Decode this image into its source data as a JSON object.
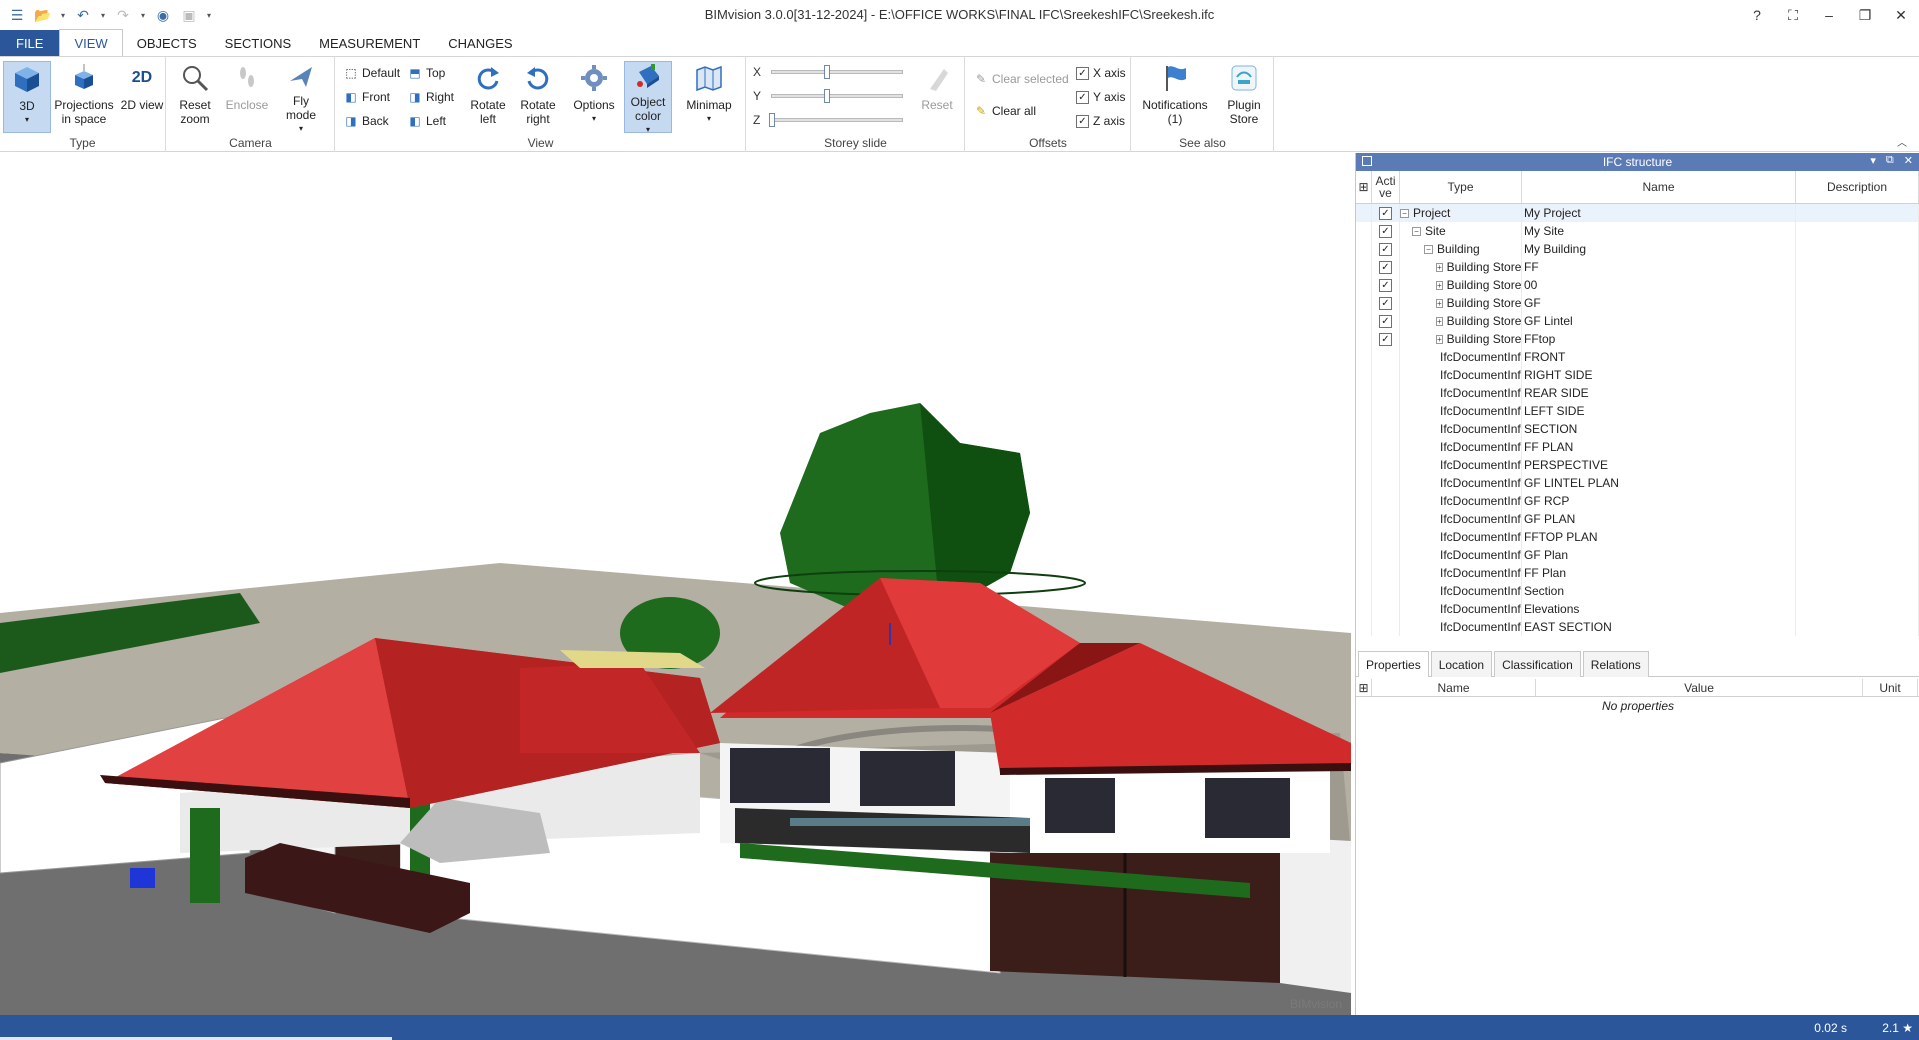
{
  "window": {
    "title": "BIMvision 3.0.0[31-12-2024] - E:\\OFFICE WORKS\\FINAL IFC\\SreekeshIFC\\Sreekesh.ifc",
    "controls": [
      "?",
      "⛶",
      "–",
      "❐",
      "✕"
    ]
  },
  "ribbon_tabs": [
    "FILE",
    "VIEW",
    "OBJECTS",
    "SECTIONS",
    "MEASUREMENT",
    "CHANGES"
  ],
  "ribbon": {
    "type_group": {
      "label": "Type",
      "btn_3d": "3D",
      "btn_proj": "Projections in space",
      "btn_2d": "2D view"
    },
    "camera_group": {
      "label": "Camera",
      "reset": "Reset zoom",
      "enclose": "Enclose",
      "fly": "Fly mode"
    },
    "view_group": {
      "label": "View",
      "default": "Default",
      "top": "Top",
      "front": "Front",
      "right": "Right",
      "back": "Back",
      "left": "Left",
      "rotate_left": "Rotate left",
      "rotate_right": "Rotate right",
      "options": "Options",
      "object_color": "Object color",
      "minimap": "Minimap"
    },
    "storey_group": {
      "label": "Storey slide",
      "x": "X",
      "y": "Y",
      "z": "Z",
      "reset": "Reset",
      "x_level": 0.42,
      "y_level": 0.42,
      "z_level": 0.0
    },
    "offsets_group": {
      "label": "Offsets",
      "clear_selected": "Clear selected",
      "clear_all": "Clear all",
      "x_axis": "X axis",
      "y_axis": "Y axis",
      "z_axis": "Z axis"
    },
    "see_also_group": {
      "label": "See also",
      "notifications": "Notifications (1)",
      "plugin_store": "Plugin Store"
    }
  },
  "ifc_panel": {
    "title": "IFC structure",
    "columns": {
      "active": "Acti ve",
      "type": "Type",
      "name": "Name",
      "description": "Description"
    },
    "rows": [
      {
        "type": "Project",
        "name": "My Project",
        "checked": true,
        "toggle": "-"
      },
      {
        "type": "Site",
        "name": "My Site",
        "checked": true,
        "toggle": "-"
      },
      {
        "type": "Building",
        "name": "My Building",
        "checked": true,
        "toggle": "-"
      },
      {
        "type": "Building Storey",
        "name": "FF",
        "checked": true,
        "toggle": "+"
      },
      {
        "type": "Building Storey",
        "name": "00",
        "checked": true,
        "toggle": "+"
      },
      {
        "type": "Building Storey",
        "name": "GF",
        "checked": true,
        "toggle": "+"
      },
      {
        "type": "Building Storey",
        "name": "GF Lintel",
        "checked": true,
        "toggle": "+"
      },
      {
        "type": "Building Storey",
        "name": "FFtop",
        "checked": true,
        "toggle": "+"
      },
      {
        "type": "IfcDocumentInfo...",
        "name": "FRONT"
      },
      {
        "type": "IfcDocumentInfo...",
        "name": "RIGHT SIDE"
      },
      {
        "type": "IfcDocumentInfo...",
        "name": "REAR SIDE"
      },
      {
        "type": "IfcDocumentInfo...",
        "name": "LEFT SIDE"
      },
      {
        "type": "IfcDocumentInfo...",
        "name": "SECTION"
      },
      {
        "type": "IfcDocumentInfo...",
        "name": "FF PLAN"
      },
      {
        "type": "IfcDocumentInfo...",
        "name": "PERSPECTIVE"
      },
      {
        "type": "IfcDocumentInfo...",
        "name": "GF LINTEL PLAN"
      },
      {
        "type": "IfcDocumentInfo...",
        "name": "GF RCP"
      },
      {
        "type": "IfcDocumentInfo...",
        "name": "GF PLAN"
      },
      {
        "type": "IfcDocumentInfo...",
        "name": "FFTOP PLAN"
      },
      {
        "type": "IfcDocumentInfo...",
        "name": "GF Plan"
      },
      {
        "type": "IfcDocumentInfo...",
        "name": "FF Plan"
      },
      {
        "type": "IfcDocumentInfo...",
        "name": "Section"
      },
      {
        "type": "IfcDocumentInfo...",
        "name": "Elevations"
      },
      {
        "type": "IfcDocumentInfo...",
        "name": "EAST SECTION"
      }
    ]
  },
  "props_panel": {
    "tabs": [
      "Properties",
      "Location",
      "Classification",
      "Relations"
    ],
    "columns": {
      "name": "Name",
      "value": "Value",
      "unit": "Unit"
    },
    "empty_text": "No properties"
  },
  "viewport": {
    "watermark": "BIMvision"
  },
  "status": {
    "time": "0.02 s",
    "version": "2.1 ★"
  },
  "colors": {
    "brand": "#2b579a",
    "roof": "#d12a2a",
    "tree": "#1e6b1e"
  }
}
